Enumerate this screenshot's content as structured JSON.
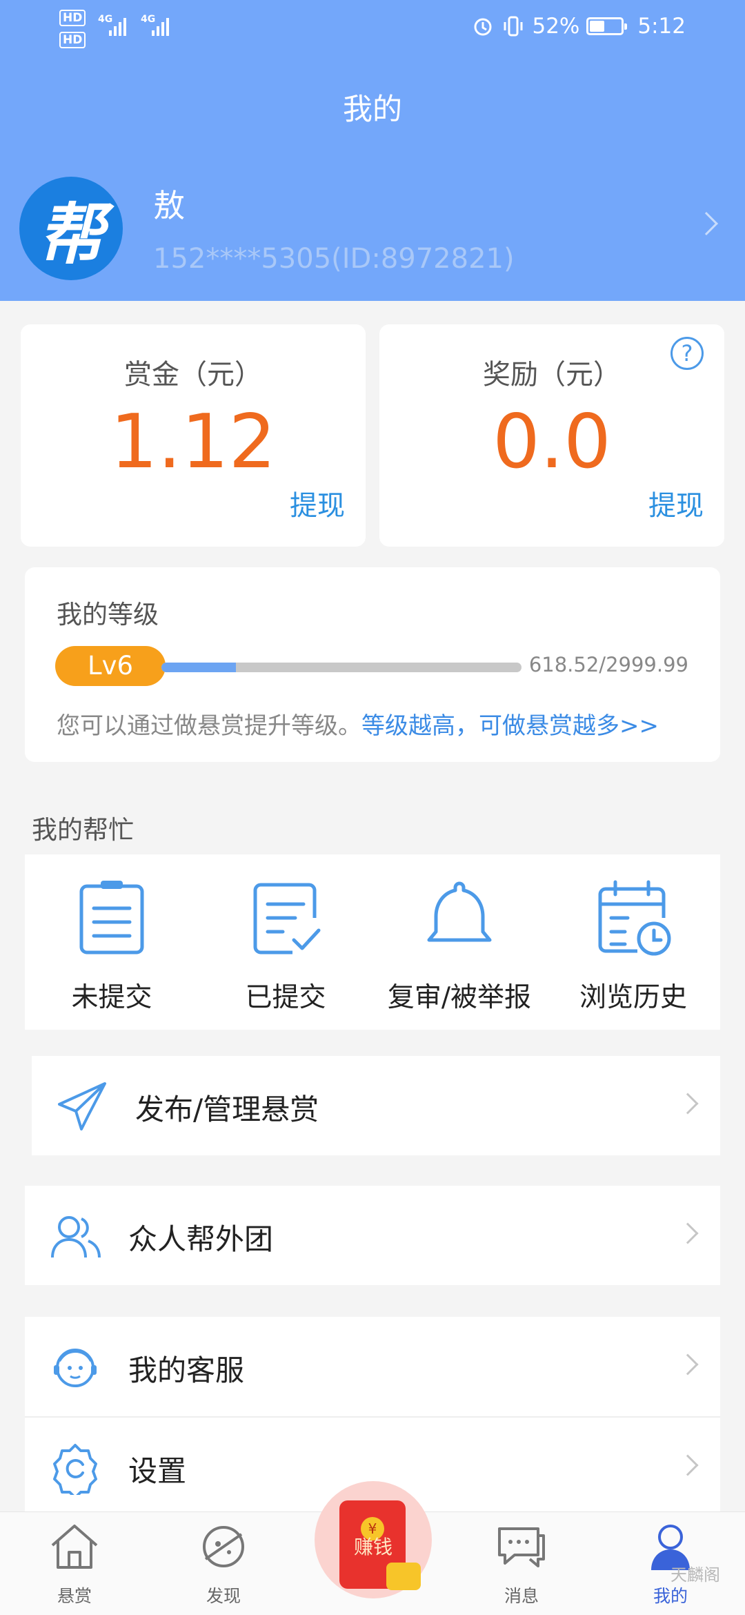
{
  "status_bar": {
    "network1": "HD",
    "network2": "HD",
    "gen1": "4G",
    "gen2": "4G",
    "battery": "52%",
    "battery_level": 0.52,
    "time": "5:12"
  },
  "header": {
    "title": "我的",
    "user_name": "敖",
    "user_info": "152****5305(ID:8972821)",
    "avatar_char": "帮"
  },
  "balance": {
    "reward_label": "赏金（元）",
    "reward_value": "1.12",
    "bonus_label": "奖励（元）",
    "bonus_value": "0.0",
    "withdraw": "提现",
    "help": "?"
  },
  "level": {
    "title": "我的等级",
    "badge": "Lv6",
    "progress_text": "618.52/2999.99",
    "progress": 0.206,
    "tip": "您可以通过做悬赏提升等级。",
    "tip_link": "等级越高，可做悬赏越多>>"
  },
  "my_help": {
    "title": "我的帮忙",
    "items": [
      {
        "label": "未提交",
        "icon": "clipboard-icon"
      },
      {
        "label": "已提交",
        "icon": "clipboard-check-icon"
      },
      {
        "label": "复审/被举报",
        "icon": "bell-icon"
      },
      {
        "label": "浏览历史",
        "icon": "calendar-clock-icon"
      }
    ]
  },
  "menu": [
    {
      "label": "发布/管理悬赏",
      "icon": "paper-plane-icon"
    },
    {
      "label": "众人帮外团",
      "icon": "users-icon"
    },
    {
      "label": "我的客服",
      "icon": "customer-service-icon"
    },
    {
      "label": "设置",
      "icon": "settings-icon"
    }
  ],
  "tabbar": {
    "items": [
      {
        "label": "悬赏",
        "icon": "home-icon"
      },
      {
        "label": "发现",
        "icon": "planet-icon"
      },
      {
        "label": "赚钱",
        "icon": "red-envelope-icon"
      },
      {
        "label": "消息",
        "icon": "chat-icon"
      },
      {
        "label": "我的",
        "icon": "profile-icon"
      }
    ],
    "center_coin": "¥"
  },
  "watermark": "天麟阁",
  "colors": {
    "header": "#73a7fa",
    "accent_orange": "#ef6a1e",
    "link_blue": "#2a8fe0",
    "badge": "#f7a01b",
    "tab_active": "#3a63d9"
  }
}
